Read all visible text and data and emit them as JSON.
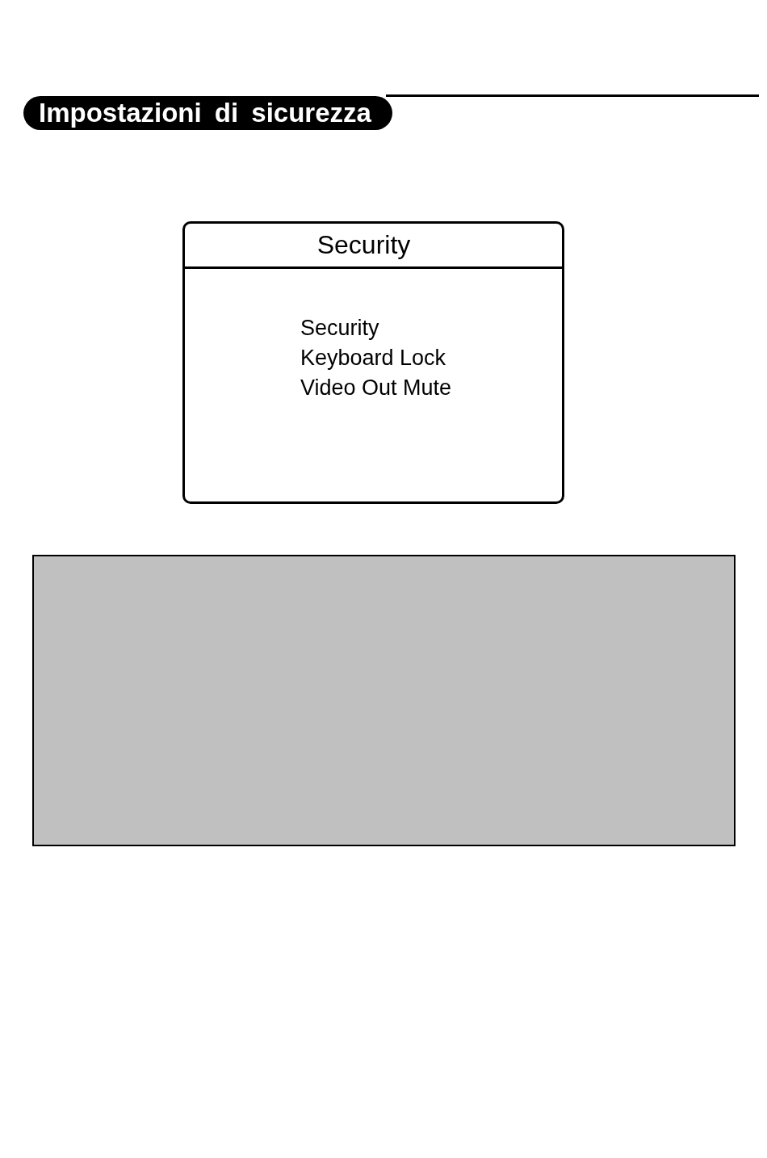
{
  "section_title": "Impostazioni di sicurezza",
  "menu": {
    "title": "Security",
    "items": [
      "Security",
      "Keyboard Lock",
      "Video Out Mute"
    ]
  }
}
